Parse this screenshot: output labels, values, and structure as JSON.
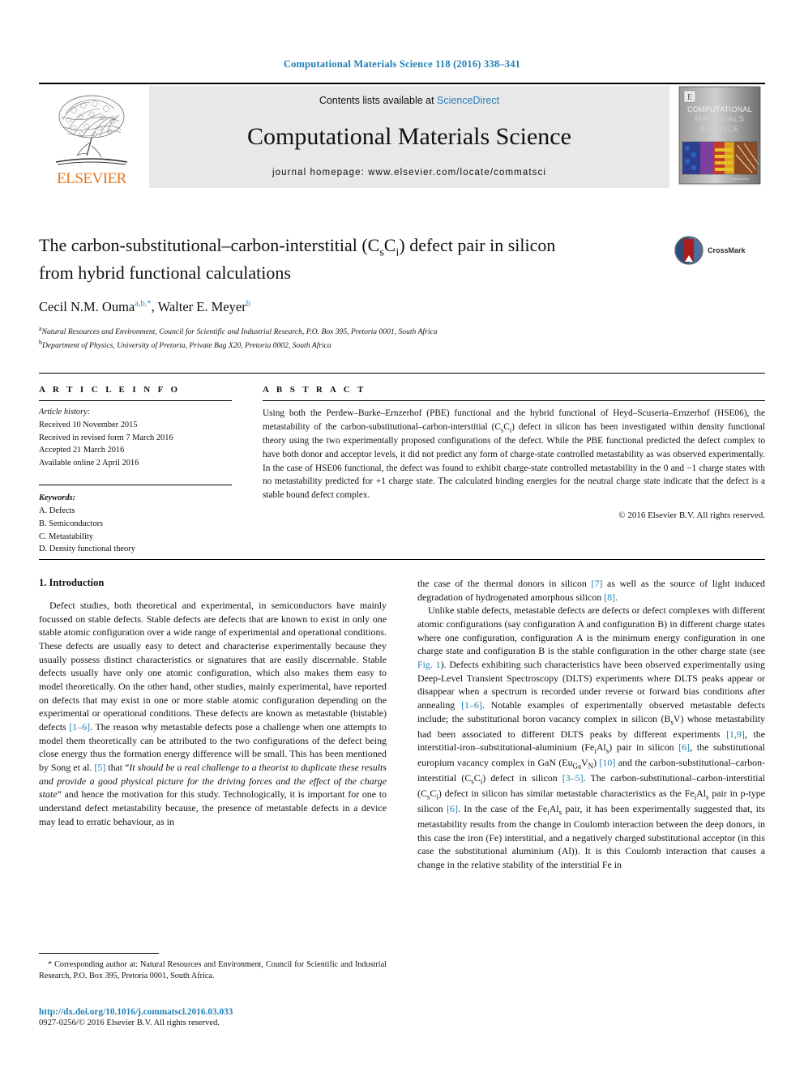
{
  "running_head": "Computational Materials Science 118 (2016) 338–341",
  "masthead": {
    "publisher_name": "ELSEVIER",
    "contents_prefix": "Contents lists available at ",
    "contents_link": "ScienceDirect",
    "journal_name": "Computational Materials Science",
    "homepage": "journal homepage: www.elsevier.com/locate/commatsci",
    "cover_line1": "COMPUTATIONAL",
    "cover_line2": "MATERIALS",
    "cover_line3": "SCIENCE"
  },
  "article": {
    "title_line1": "The carbon-substitutional–carbon-interstitial (CsCi) defect pair in silicon",
    "title_line2": "from hybrid functional calculations",
    "crossmark_label": "CrossMark",
    "authors": "Cecil N.M. Ouma, Walter E. Meyer",
    "author1_name": "Cecil N.M. Ouma",
    "author1_sup": "a,b,",
    "author1_star": "*",
    "author2_name": "Walter E. Meyer",
    "author2_sup": "b",
    "affiliation_a_sup": "a",
    "affiliation_a": "Natural Resources and Environment, Council for Scientific and Industrial Research, P.O. Box 395, Pretoria 0001, South Africa",
    "affiliation_b_sup": "b",
    "affiliation_b": "Department of Physics, University of Pretoria, Private Bag X20, Pretoria 0002, South Africa"
  },
  "article_info": {
    "heading": "A R T I C L E   I N F O",
    "history_label": "Article history:",
    "history": [
      "Received 10 November 2015",
      "Received in revised form 7 March 2016",
      "Accepted 21 March 2016",
      "Available online 2 April 2016"
    ],
    "keywords_label": "Keywords:",
    "keywords": [
      "A. Defects",
      "B. Semiconductors",
      "C. Metastability",
      "D. Density functional theory"
    ]
  },
  "abstract": {
    "heading": "A B S T R A C T",
    "text": "Using both the Perdew–Burke–Ernzerhof (PBE) functional and the hybrid functional of Heyd–Scuseria–Ernzerhof (HSE06), the metastability of the carbon-substitutional–carbon-interstitial (CsCi) defect in silicon has been investigated within density functional theory using the two experimentally proposed configurations of the defect. While the PBE functional predicted the defect complex to have both donor and acceptor levels, it did not predict any form of charge-state controlled metastability as was observed experimentally. In the case of HSE06 functional, the defect was found to exhibit charge-state controlled metastability in the 0 and −1 charge states with no metastability predicted for +1 charge state. The calculated binding energies for the neutral charge state indicate that the defect is a stable bound defect complex.",
    "copyright": "© 2016 Elsevier B.V. All rights reserved."
  },
  "body": {
    "section1_heading": "1. Introduction",
    "left_para1": "Defect studies, both theoretical and experimental, in semiconductors have mainly focussed on stable defects. Stable defects are defects that are known to exist in only one stable atomic configuration over a wide range of experimental and operational conditions. These defects are usually easy to detect and characterise experimentally because they usually possess distinct characteristics or signatures that are easily discernable. Stable defects usually have only one atomic configuration, which also makes them easy to model theoretically. On the other hand, other studies, mainly experimental, have reported on defects that may exist in one or more stable atomic configuration depending on the experimental or operational conditions. These defects are known as metastable (bistable) defects [1–6]. The reason why metastable defects pose a challenge when one attempts to model them theoretically can be attributed to the two configurations of the defect being close energy thus the formation energy difference will be small. This has been mentioned by Song et al. [5] that \"It should be a real challenge to a theorist to duplicate these results and provide a good physical picture for the driving forces and the effect of the charge state\" and hence the motivation for this study. Technologically, it is important for one to understand defect metastability because, the presence of metastable defects in a device may lead to erratic behaviour, as in",
    "right_para1_cont": "the case of the thermal donors in silicon [7] as well as the source of light induced degradation of hydrogenated amorphous silicon [8].",
    "right_para2": "Unlike stable defects, metastable defects are defects or defect complexes with different atomic configurations (say configuration A and configuration B) in different charge states where one configuration, configuration A is the minimum energy configuration in one charge state and configuration B is the stable configuration in the other charge state (see Fig. 1). Defects exhibiting such characteristics have been observed experimentally using Deep-Level Transient Spectroscopy (DLTS) experiments where DLTS peaks appear or disappear when a spectrum is recorded under reverse or forward bias conditions after annealing [1–6]. Notable examples of experimentally observed metastable defects include; the substitutional boron vacancy complex in silicon (BsV) whose metastability had been associated to different DLTS peaks by different experiments [1,9], the interstitial-iron–substitutional-aluminium (FeiAls) pair in silicon [6], the substitutional europium vacancy complex in GaN (EuGaVN) [10] and the carbon-substitutional–carbon-interstitial (CsCi) defect in silicon [3–5]. The carbon-substitutional–carbon-interstitial (CsCi) defect in silicon has similar metastable characteristics as the FeiAls pair in p-type silicon [6]. In the case of the FeiAls pair, it has been experimentally suggested that, its metastability results from the change in Coulomb interaction between the deep donors, in this case the iron (Fe) interstitial, and a negatively charged substitutional acceptor (in this case the substitutional aluminium (Al)). It is this Coulomb interaction that causes a change in the relative stability of the interstitial Fe in"
  },
  "footer": {
    "corresponding_marker": "*",
    "corresponding_note": "Corresponding author at: Natural Resources and Environment, Council for Scientific and Industrial Research, P.O. Box 395, Pretoria 0001, South Africa.",
    "doi": "http://dx.doi.org/10.1016/j.commatsci.2016.03.033",
    "issn_line": "0927-0256/© 2016 Elsevier B.V. All rights reserved."
  },
  "colors": {
    "link": "#1f7fb6",
    "sciencedirect": "#2a7fbd",
    "elsevier_orange": "#e87722",
    "band_gray": "#e8e8e8"
  }
}
